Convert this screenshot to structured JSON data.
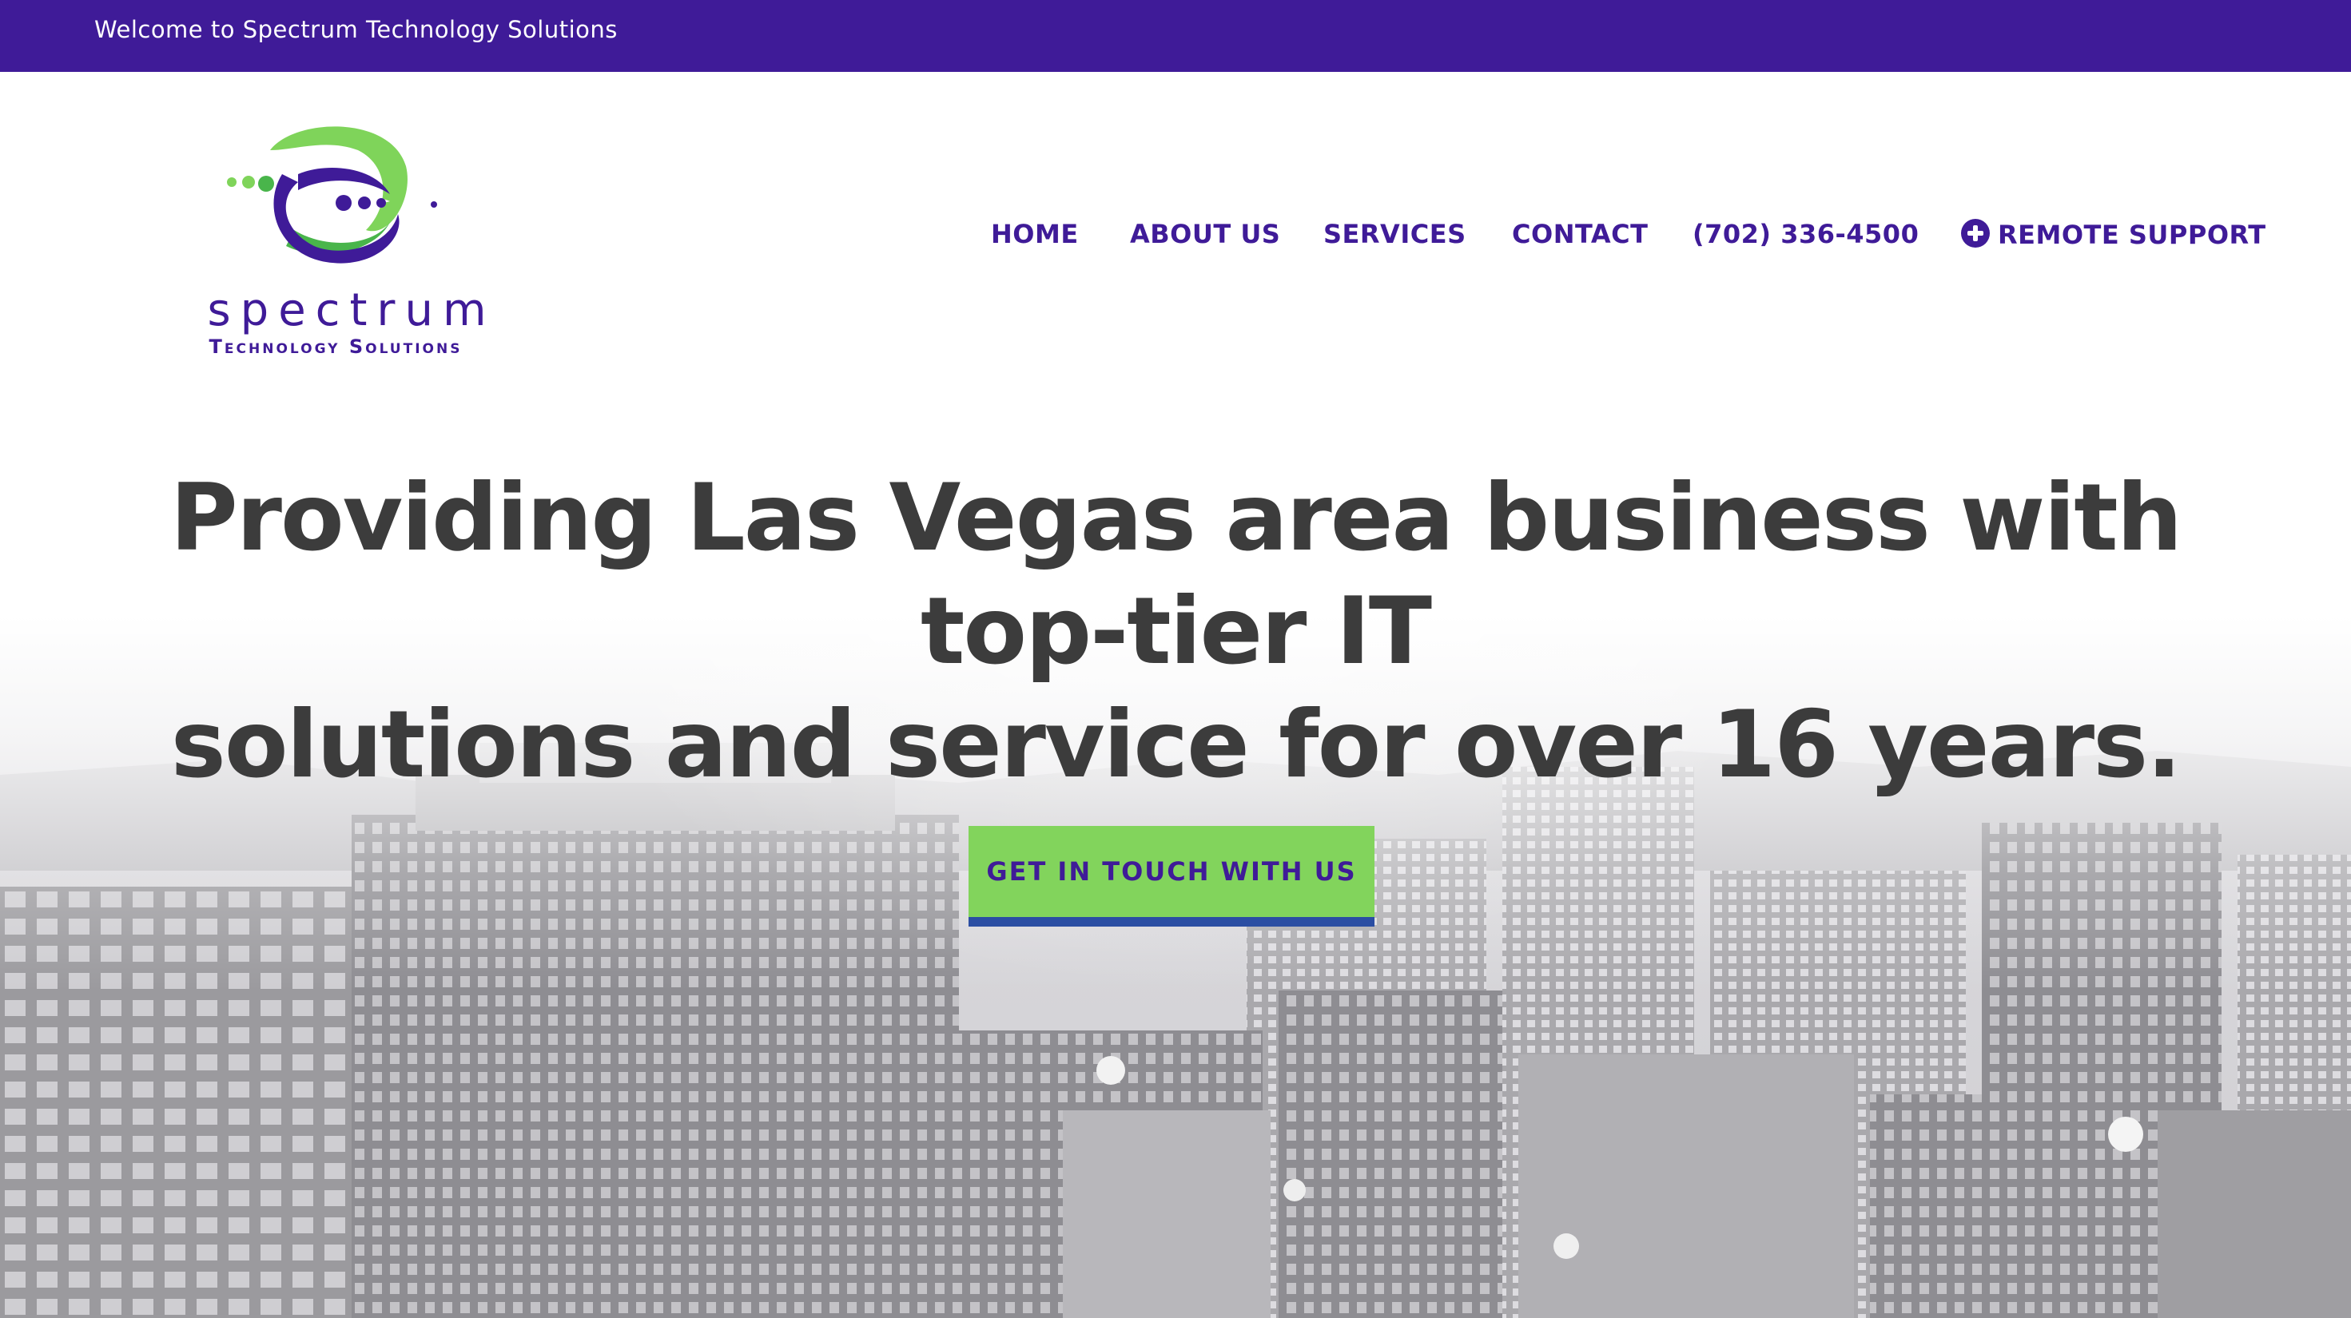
{
  "topbar": {
    "welcome_text": "Welcome to Spectrum Technology Solutions",
    "background_color": "#3f1b98"
  },
  "logo": {
    "wordmark": "spectrum",
    "tagline": "Technology Solutions",
    "colors": {
      "purple": "#3f1b98",
      "green": "#7fd45a"
    }
  },
  "nav": {
    "items": [
      {
        "label": "HOME"
      },
      {
        "label": "ABOUT US"
      },
      {
        "label": "SERVICES"
      },
      {
        "label": "CONTACT"
      },
      {
        "label": "(702) 336-4500"
      },
      {
        "label": "REMOTE SUPPORT",
        "icon": "plus-circle-icon"
      }
    ],
    "text_color": "#3f1b98"
  },
  "hero": {
    "headline_line1": "Providing Las Vegas area business with top-tier IT",
    "headline_line2": "solutions and service for over 16 years.",
    "cta_label": "GET IN TOUCH WITH US",
    "cta_color": "#82d45c",
    "cta_underline_color": "#2b4ea3",
    "background": "grayscale Las Vegas skyline photo"
  }
}
